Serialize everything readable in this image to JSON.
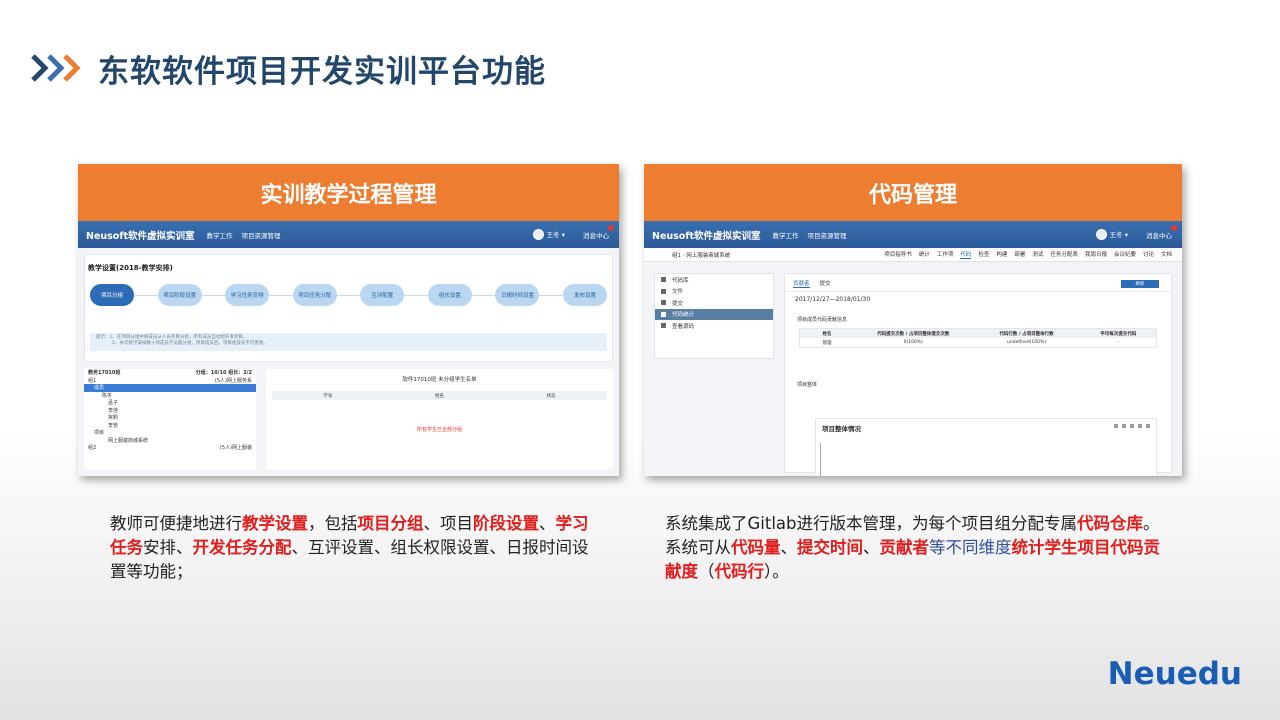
{
  "slide": {
    "title": "东软软件项目开发实训平台功能",
    "logo": "Neuedu"
  },
  "left_card": {
    "header": "实训教学过程管理",
    "app": {
      "brand": "Neusoft软件虚拟实训室",
      "nav": [
        "教学工作",
        "项目资源管理"
      ],
      "user": "王冬",
      "msg": "消息中心",
      "panel_title": "教学设置(2018-教学安排)",
      "steps": [
        "项目分组",
        "项目阶段设置",
        "学习任务安排",
        "项目任务分配",
        "互评配置",
        "组长设置",
        "日报时间设置",
        "发布设置"
      ],
      "tip_line1": "提示：1、在项目分组中将成员从人员项目分组，所有成员自动配开发项目。",
      "tip_line2": "2、本次教学安排数十项成员学员都分组，项目成员后，项目组成员不可更改。",
      "tree_header": "教务17010班",
      "tree_meta": "分组：10/10  组长：2/2",
      "tree_rows": [
        {
          "label": "组1",
          "meta": "(5人)网上服务系"
        },
        {
          "label": "成员",
          "meta": ""
        },
        {
          "label": "陈冬",
          "meta": ""
        },
        {
          "label": "孟子",
          "meta": ""
        },
        {
          "label": "李佳",
          "meta": ""
        },
        {
          "label": "常购",
          "meta": ""
        },
        {
          "label": "李管",
          "meta": ""
        },
        {
          "label": "项目",
          "meta": ""
        },
        {
          "label": "网上服装商城系统",
          "meta": ""
        },
        {
          "label": "组2",
          "meta": "(5人)网上服装"
        }
      ],
      "right_title": "软件17010班  未分组学生名单",
      "table_cols": [
        "学号",
        "姓名",
        "状态"
      ],
      "empty_text": "所有学生已全部分组"
    }
  },
  "right_card": {
    "header": "代码管理",
    "app": {
      "brand": "Neusoft软件虚拟实训室",
      "nav": [
        "教学工作",
        "项目资源管理"
      ],
      "user": "王冬",
      "msg": "消息中心",
      "crumb": "组1  ·  网上服装商城系统",
      "subnav": [
        "项目指导书",
        "统计",
        "工作项",
        "代码",
        "检查",
        "构建",
        "部署",
        "测试",
        "任务分配表",
        "我周日报",
        "会议纪要",
        "讨论",
        "文档"
      ],
      "side_items": [
        "代码库",
        "文件",
        "提交",
        "代码统计",
        "查看源码"
      ],
      "tabs": [
        "贡献者",
        "提交"
      ],
      "button": "刷新",
      "date_range": "2017/12/27—2018/01/30",
      "section1": "项目成员代码贡献信息",
      "table_head": [
        "姓名",
        "代码提交次数 / 占项目整体提交次数",
        "代码行数 / 占项目整体行数",
        "平均每次提交代码"
      ],
      "table_row": [
        "管理",
        "0(100%)",
        "undefined(100%)",
        "-"
      ],
      "section2": "项目整体",
      "chart_title": "项目整体情况"
    }
  },
  "captions": {
    "left": [
      {
        "t": "教师可便捷地进行",
        "s": "n"
      },
      {
        "t": "教学设置",
        "s": "r"
      },
      {
        "t": "，包括",
        "s": "n"
      },
      {
        "t": "项目分组",
        "s": "r"
      },
      {
        "t": "、项目",
        "s": "n"
      },
      {
        "t": "阶段设置",
        "s": "r"
      },
      {
        "t": "、",
        "s": "n"
      },
      {
        "t": "学习任务",
        "s": "r"
      },
      {
        "t": "安排、",
        "s": "n"
      },
      {
        "t": "开发任务分配",
        "s": "r"
      },
      {
        "t": "、互评设置、组长权限设置、日报时间设置等功能；",
        "s": "n"
      }
    ],
    "right": [
      {
        "t": "系统集成了Gitlab进行版本管理，为每个项目组分配专属",
        "s": "n"
      },
      {
        "t": "代码仓库",
        "s": "r"
      },
      {
        "t": "。系统可从",
        "s": "n"
      },
      {
        "t": "代码量",
        "s": "r"
      },
      {
        "t": "、",
        "s": "n"
      },
      {
        "t": "提交时间",
        "s": "r"
      },
      {
        "t": "、",
        "s": "n"
      },
      {
        "t": "贡献者",
        "s": "r"
      },
      {
        "t": "等不同维度",
        "s": "b"
      },
      {
        "t": "统计学生项目代码贡献度",
        "s": "r"
      },
      {
        "t": "（",
        "s": "n"
      },
      {
        "t": "代码行",
        "s": "r"
      },
      {
        "t": "）。",
        "s": "n"
      }
    ]
  },
  "colors": {
    "title": "#23476b",
    "card_header": "#ed7d31",
    "highlight": "#e01e1e",
    "logo": "#1a5db5",
    "chevron_blue": "#23476b",
    "chevron_orange": "#ed7d31"
  }
}
